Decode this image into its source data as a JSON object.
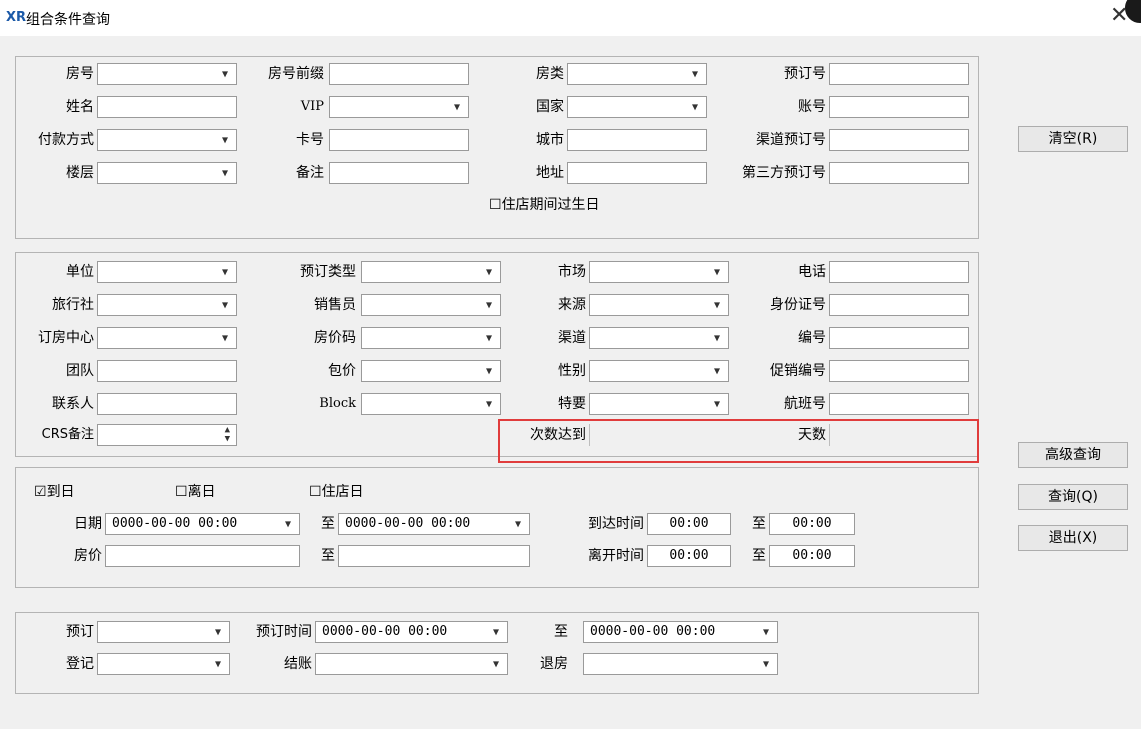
{
  "window": {
    "title": "组合条件查询",
    "logo": "XR",
    "close": "✕"
  },
  "g1": {
    "room_no": "房号",
    "room_prefix": "房号前缀",
    "room_type": "房类",
    "resv_no": "预订号",
    "name": "姓名",
    "vip": "VIP",
    "country": "国家",
    "account_no": "账号",
    "payment": "付款方式",
    "card_no": "卡号",
    "city": "城市",
    "channel_resv_no": "渠道预订号",
    "floor": "楼层",
    "remark": "备注",
    "address": "地址",
    "third_party_resv_no": "第三方预订号",
    "birthday_check": "住店期间过生日"
  },
  "g2": {
    "unit": "单位",
    "resv_type": "预订类型",
    "market": "市场",
    "phone": "电话",
    "agency": "旅行社",
    "salesperson": "销售员",
    "source": "来源",
    "id_card": "身份证号",
    "booking_center": "订房中心",
    "rate_code": "房价码",
    "channel": "渠道",
    "code": "编号",
    "group": "团队",
    "package": "包价",
    "gender": "性别",
    "promo_no": "促销编号",
    "contact": "联系人",
    "block": "Block",
    "special": "特要",
    "flight_no": "航班号",
    "crs_remark": "CRS备注",
    "count_reach": "次数达到",
    "days": "天数"
  },
  "g3": {
    "arrival_check": "到日",
    "departure_check": "离日",
    "staying_check": "住店日",
    "date": "日期",
    "date_from": "0000-00-00 00:00",
    "to1": "至",
    "date_to": "0000-00-00 00:00",
    "arrive_time": "到达时间",
    "arrive_from": "00:00",
    "to2": "至",
    "arrive_to": "00:00",
    "rate": "房价",
    "to3": "至",
    "leave_time": "离开时间",
    "leave_from": "00:00",
    "to4": "至",
    "leave_to": "00:00"
  },
  "g4": {
    "resv": "预订",
    "resv_time": "预订时间",
    "resv_from": "0000-00-00 00:00",
    "to": "至",
    "resv_to": "0000-00-00 00:00",
    "checkin": "登记",
    "checkout": "结账",
    "checkout_room": "退房"
  },
  "buttons": {
    "clear": "清空(R)",
    "advanced": "高级查询",
    "query": "查询(Q)",
    "exit": "退出(X)"
  },
  "checks": {
    "arrival_checked": "☑",
    "unchecked": "☐"
  }
}
